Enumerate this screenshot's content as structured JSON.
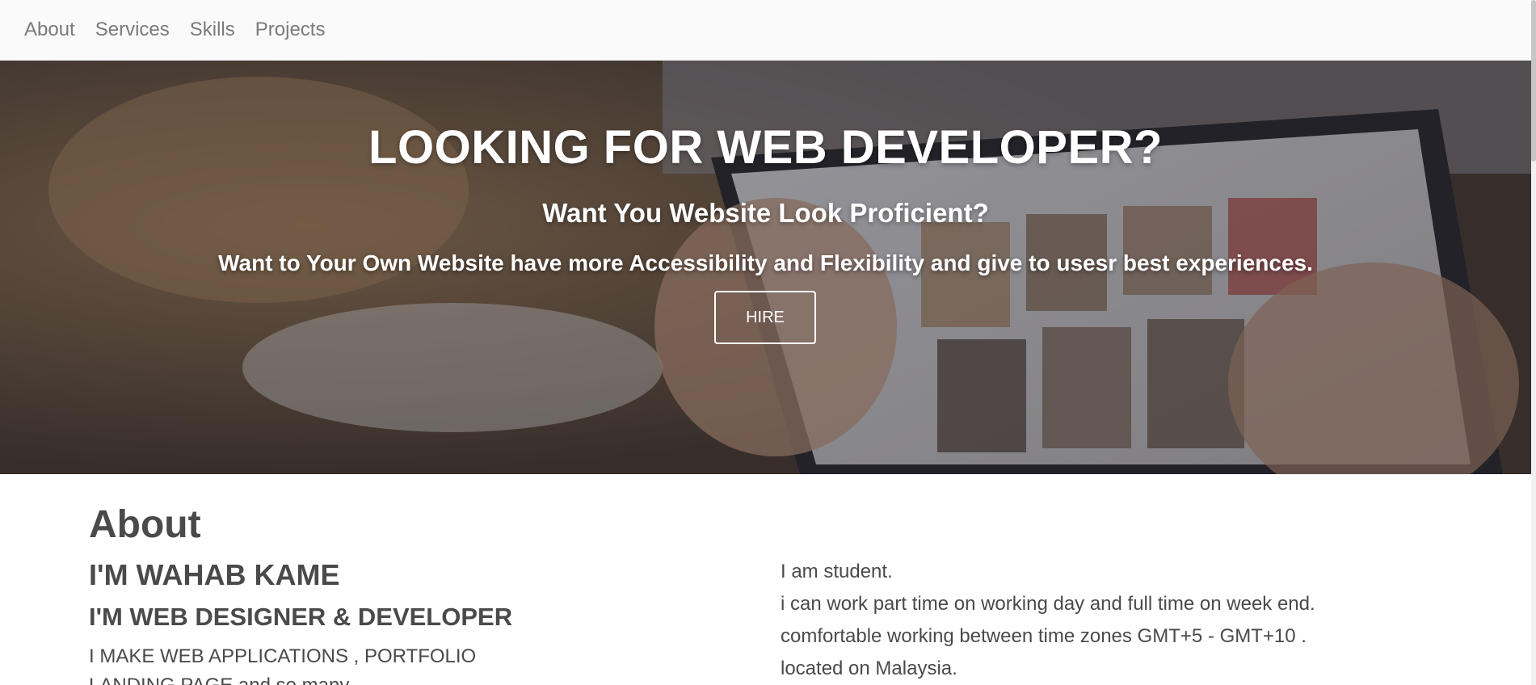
{
  "nav": {
    "items": [
      {
        "label": "About"
      },
      {
        "label": "Services"
      },
      {
        "label": "Skills"
      },
      {
        "label": "Projects"
      }
    ]
  },
  "hero": {
    "title": "LOOKING FOR WEB DEVELOPER?",
    "subtitle": "Want You Website Look Proficient?",
    "text": "Want to Your Own Website have more Accessibility and Flexibility and give to usesr best experiences.",
    "button_label": "HIRE"
  },
  "about": {
    "heading": "About",
    "name": "I'M WAHAB KAME",
    "role": "I'M WEB DESIGNER & DEVELOPER",
    "description": "I MAKE WEB APPLICATIONS , PORTFOLIO LANDING PAGE and so many",
    "info": [
      "I am student.",
      "i can work part time on working day and full time on week end.",
      "comfortable working between time zones GMT+5 - GMT+10 .",
      "located on Malaysia."
    ]
  },
  "colors": {
    "nav_background": "#fafafa",
    "nav_text": "#7a7a7a",
    "hero_text": "#ffffff",
    "body_text": "#4a4a4a"
  }
}
